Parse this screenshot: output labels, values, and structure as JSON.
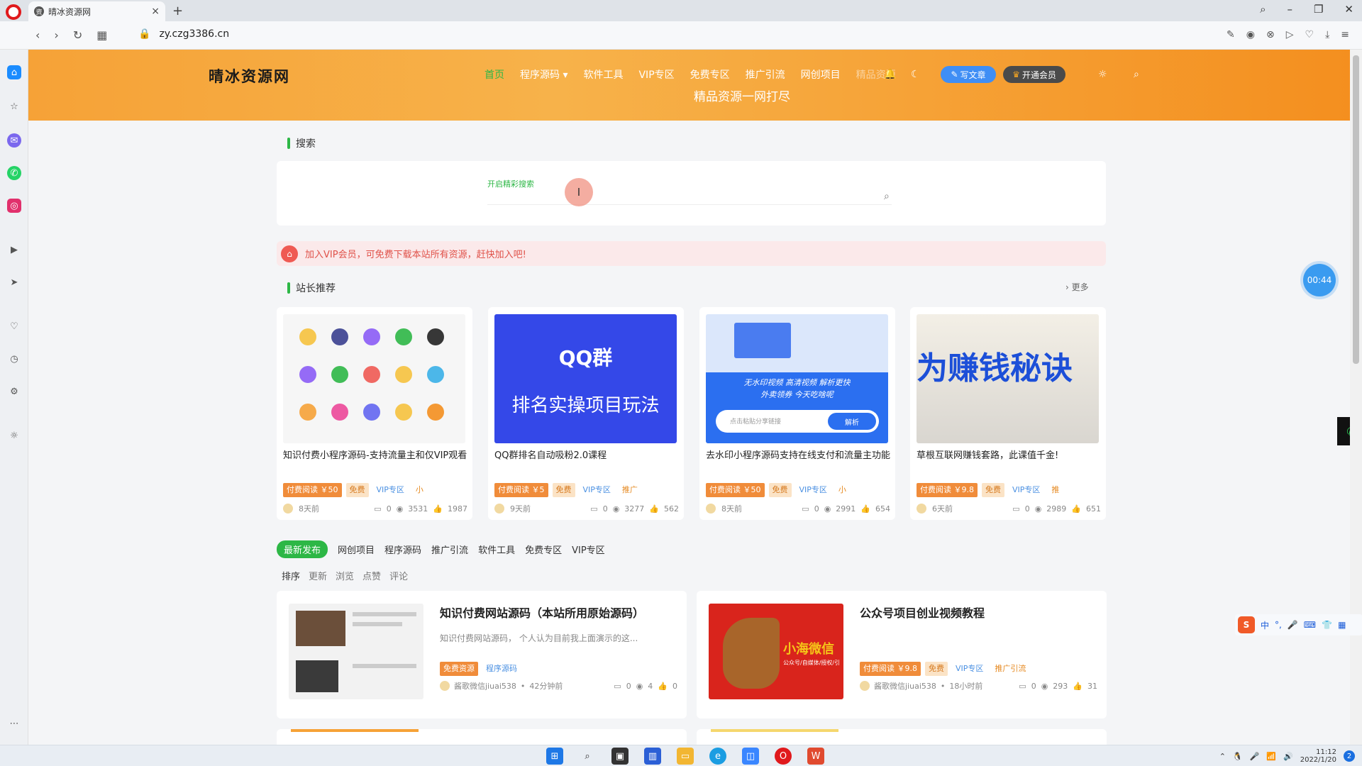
{
  "browser": {
    "tab_title": "晴冰资源网",
    "tab_favicon": "资",
    "tab_close": "×",
    "new_tab": "+",
    "url": "zy.czg3386.cn"
  },
  "site": {
    "logo": "晴冰资源网",
    "nav": [
      "首页",
      "程序源码 ▾",
      "软件工具",
      "VIP专区",
      "免费专区",
      "推广引流",
      "网创项目"
    ],
    "nav_faded": "精品资源",
    "subtitle": "精品资源一网打尽",
    "write_btn": "写文章",
    "vip_btn": "开通会员",
    "accent": "#2db746",
    "hero_color": "#f6a237"
  },
  "search": {
    "section_title": "搜索",
    "label": "开启精彩搜索",
    "placeholder": ""
  },
  "notice": "加入VIP会员，可免费下载本站所有资源，赶快加入吧!",
  "recommend": {
    "section_title": "站长推荐",
    "more": "更多",
    "cards": [
      {
        "title": "知识付费小程序源码-支持流量主和仅VIP观看",
        "paid": "付费阅读 ￥50",
        "free": "免费",
        "vip": "VIP专区",
        "cat": "小",
        "time": "8天前",
        "comments": "0",
        "views": "3531",
        "likes": "1987"
      },
      {
        "title": "QQ群排名自动吸粉2.0课程",
        "paid": "付费阅读 ￥5",
        "free": "免费",
        "vip": "VIP专区",
        "cat": "推广",
        "time": "9天前",
        "comments": "0",
        "views": "3277",
        "likes": "562",
        "thumb_line1": "QQ群",
        "thumb_line2": "排名实操项目玩法"
      },
      {
        "title": "去水印小程序源码支持在线支付和流量主功能",
        "paid": "付费阅读 ￥50",
        "free": "免费",
        "vip": "VIP专区",
        "cat": "小",
        "time": "8天前",
        "comments": "0",
        "views": "2991",
        "likes": "654",
        "thumb_line1": "无水印视频    高清视频    解析更快",
        "thumb_line2": "外卖领券    今天吃啥呢",
        "thumb_btn": "解析",
        "thumb_input": "点击粘贴分享链接"
      },
      {
        "title": "草根互联网赚钱套路，此课值千金!",
        "paid": "付费阅读 ￥9.8",
        "free": "免费",
        "vip": "VIP专区",
        "cat": "推",
        "time": "6天前",
        "comments": "0",
        "views": "2989",
        "likes": "651",
        "thumb_line1": "为赚钱秘诀"
      }
    ]
  },
  "filter_tabs": [
    "最新发布",
    "网创项目",
    "程序源码",
    "推广引流",
    "软件工具",
    "免费专区",
    "VIP专区"
  ],
  "sort": {
    "label": "排序",
    "options": [
      "更新",
      "浏览",
      "点赞",
      "评论"
    ]
  },
  "list": [
    {
      "title": "知识付费网站源码（本站所用原始源码）",
      "desc": "知识付费网站源码， 个人认为目前我上面演示的这...",
      "tag1": "免费资源",
      "tag2": "程序源码",
      "author": "酱歌微信jiuai538",
      "time": "42分钟前",
      "comments": "0",
      "views": "4",
      "likes": "0"
    },
    {
      "title": "公众号项目创业视频教程",
      "desc": "",
      "tag1": "付费阅读 ￥9.8",
      "tag2": "免费",
      "tag3": "VIP专区",
      "tag4": "推广引流",
      "author": "酱歌微信jiuai538",
      "time": "18小时前",
      "comments": "0",
      "views": "293",
      "likes": "31",
      "thumb_text": "小海微信",
      "thumb_sub": "公众号/自媒体/授权/引"
    }
  ],
  "floating": {
    "timer": "00:44",
    "ime_lang": "中"
  },
  "taskbar": {
    "time": "11:12",
    "date": "2022/1/20",
    "badge": "2"
  }
}
